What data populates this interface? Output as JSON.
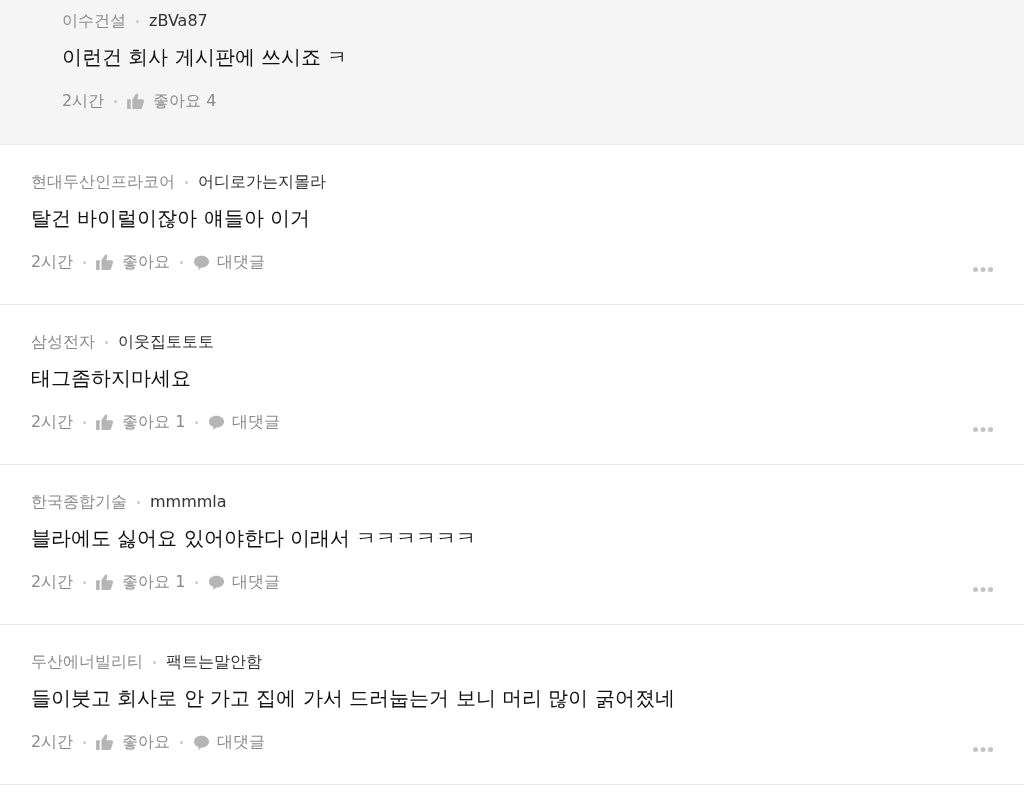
{
  "comments": [
    {
      "kind": "reply",
      "company": "이수건설",
      "author": "zBVa87",
      "text": "이런건 회사 게시판에 쓰시죠 ㅋ",
      "time": "2시간",
      "like_label": "좋아요 4"
    },
    {
      "kind": "comment",
      "company": "현대두산인프라코어",
      "author": "어디로가는지몰라",
      "text": "탈건 바이럴이잖아 얘들아 이거",
      "time": "2시간",
      "like_label": "좋아요",
      "reply_label": "대댓글"
    },
    {
      "kind": "comment",
      "company": "삼성전자",
      "author": "이웃집토토토",
      "text": "태그좀하지마세요",
      "time": "2시간",
      "like_label": "좋아요 1",
      "reply_label": "대댓글"
    },
    {
      "kind": "comment",
      "company": "한국종합기술",
      "author": "mmmmla",
      "text": "블라에도 싫어요 있어야한다 이래서 ㅋㅋㅋㅋㅋㅋ",
      "time": "2시간",
      "like_label": "좋아요 1",
      "reply_label": "대댓글"
    },
    {
      "kind": "comment",
      "company": "두산에너빌리티",
      "author": "팩트는말안함",
      "text": "들이붓고 회사로 안 가고 집에 가서 드러눕는거 보니 머리 많이 굵어졌네",
      "time": "2시간",
      "like_label": "좋아요",
      "reply_label": "대댓글"
    }
  ]
}
